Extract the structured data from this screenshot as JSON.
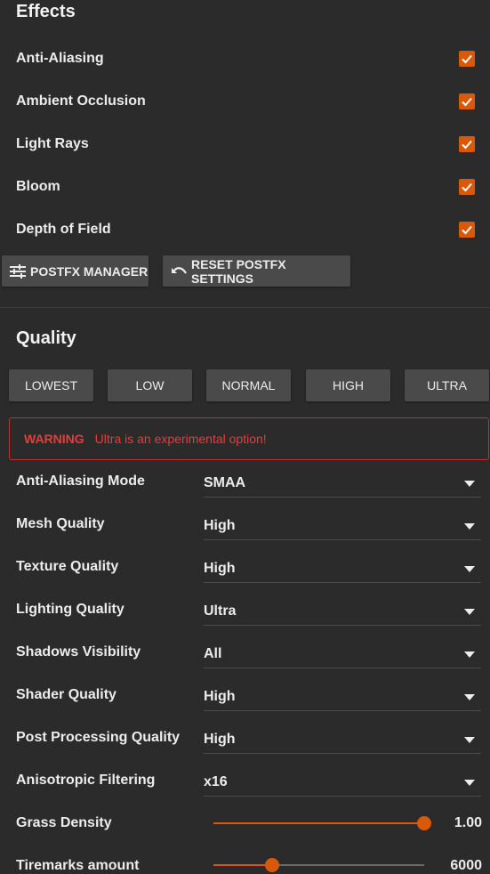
{
  "effects": {
    "title": "Effects",
    "items": [
      {
        "label": "Anti-Aliasing",
        "checked": true
      },
      {
        "label": "Ambient Occlusion",
        "checked": true
      },
      {
        "label": "Light Rays",
        "checked": true
      },
      {
        "label": "Bloom",
        "checked": true
      },
      {
        "label": "Depth of Field",
        "checked": true
      }
    ],
    "postfx_manager_label": "POSTFX MANAGER",
    "reset_postfx_label": "RESET POSTFX SETTINGS"
  },
  "quality": {
    "title": "Quality",
    "presets": [
      "LOWEST",
      "LOW",
      "NORMAL",
      "HIGH",
      "ULTRA"
    ],
    "warning": {
      "label": "WARNING",
      "text": "Ultra is an experimental option!"
    },
    "settings": [
      {
        "label": "Anti-Aliasing Mode",
        "value": "SMAA"
      },
      {
        "label": "Mesh Quality",
        "value": "High"
      },
      {
        "label": "Texture Quality",
        "value": "High"
      },
      {
        "label": "Lighting Quality",
        "value": "Ultra"
      },
      {
        "label": "Shadows Visibility",
        "value": "All"
      },
      {
        "label": "Shader Quality",
        "value": "High"
      },
      {
        "label": "Post Processing Quality",
        "value": "High"
      },
      {
        "label": "Anisotropic Filtering",
        "value": "x16"
      }
    ],
    "sliders": [
      {
        "label": "Grass Density",
        "value": "1.00",
        "fraction": 1.0
      },
      {
        "label": "Tiremarks amount",
        "value": "6000",
        "fraction": 0.28
      }
    ]
  },
  "colors": {
    "accent": "#d9590b",
    "warning": "#e63c3c",
    "background": "#2b2b2b"
  }
}
